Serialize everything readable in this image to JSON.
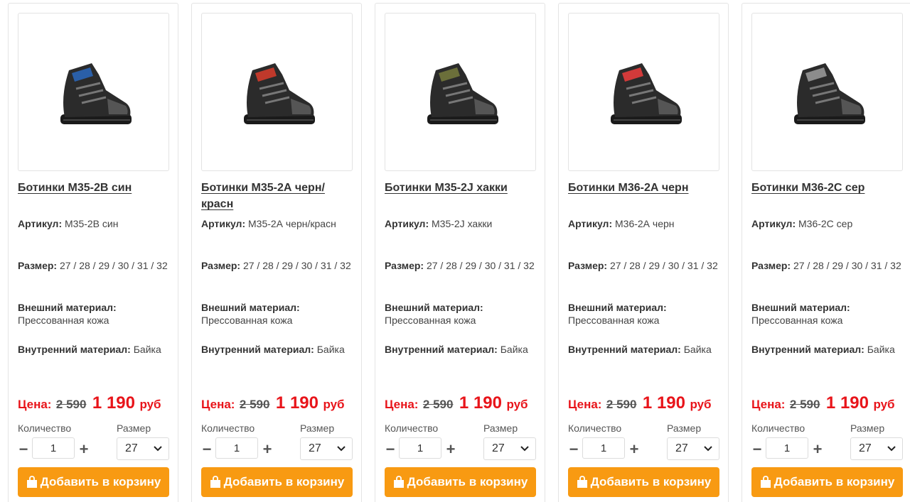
{
  "products": [
    {
      "title": "Ботинки М35-2В син",
      "article_label": "Артикул:",
      "article": "М35-2В син",
      "size_label": "Размер:",
      "sizes": "27 / 28 / 29 / 30 / 31 / 32",
      "outer_label": "Внешний материал:",
      "outer": "Прессованная кожа",
      "inner_label": "Внутренний материал:",
      "inner": "Байка",
      "price_label": "Цена:",
      "old_price": "2 590",
      "new_price": "1 190",
      "currency": "руб",
      "qty_label": "Количество",
      "qty": "1",
      "size_select_label": "Размер",
      "size_selected": "27",
      "cart_label": "Добавить в корзину",
      "accent": "#2a5fa8"
    },
    {
      "title": "Ботинки М35-2А черн/красн",
      "article_label": "Артикул:",
      "article": "М35-2А черн/красн",
      "size_label": "Размер:",
      "sizes": "27 / 28 / 29 / 30 / 31 / 32",
      "outer_label": "Внешний материал:",
      "outer": "Прессованная кожа",
      "inner_label": "Внутренний материал:",
      "inner": "Байка",
      "price_label": "Цена:",
      "old_price": "2 590",
      "new_price": "1 190",
      "currency": "руб",
      "qty_label": "Количество",
      "qty": "1",
      "size_select_label": "Размер",
      "size_selected": "27",
      "cart_label": "Добавить в корзину",
      "accent": "#c0392b"
    },
    {
      "title": "Ботинки М35-2J хакки",
      "article_label": "Артикул:",
      "article": "М35-2J хакки",
      "size_label": "Размер:",
      "sizes": "27 / 28 / 29 / 30 / 31 / 32",
      "outer_label": "Внешний материал:",
      "outer": "Прессованная кожа",
      "inner_label": "Внутренний материал:",
      "inner": "Байка",
      "price_label": "Цена:",
      "old_price": "2 590",
      "new_price": "1 190",
      "currency": "руб",
      "qty_label": "Количество",
      "qty": "1",
      "size_select_label": "Размер",
      "size_selected": "27",
      "cart_label": "Добавить в корзину",
      "accent": "#6b6f3a"
    },
    {
      "title": "Ботинки М36-2А черн",
      "article_label": "Артикул:",
      "article": "М36-2А черн",
      "size_label": "Размер:",
      "sizes": "27 / 28 / 29 / 30 / 31 / 32",
      "outer_label": "Внешний материал:",
      "outer": "Прессованная кожа",
      "inner_label": "Внутренний материал:",
      "inner": "Байка",
      "price_label": "Цена:",
      "old_price": "2 590",
      "new_price": "1 190",
      "currency": "руб",
      "qty_label": "Количество",
      "qty": "1",
      "size_select_label": "Размер",
      "size_selected": "27",
      "cart_label": "Добавить в корзину",
      "accent": "#d23a3a"
    },
    {
      "title": "Ботинки М36-2С сер",
      "article_label": "Артикул:",
      "article": "М36-2С сер",
      "size_label": "Размер:",
      "sizes": "27 / 28 / 29 / 30 / 31 / 32",
      "outer_label": "Внешний материал:",
      "outer": "Прессованная кожа",
      "inner_label": "Внутренний материал:",
      "inner": "Байка",
      "price_label": "Цена:",
      "old_price": "2 590",
      "new_price": "1 190",
      "currency": "руб",
      "qty_label": "Количество",
      "qty": "1",
      "size_select_label": "Размер",
      "size_selected": "27",
      "cart_label": "Добавить в корзину",
      "accent": "#8c8c8c"
    }
  ],
  "colors": {
    "price_red": "#e8141a",
    "cart_orange": "#f89a12",
    "card_border": "#e4e4e4"
  }
}
